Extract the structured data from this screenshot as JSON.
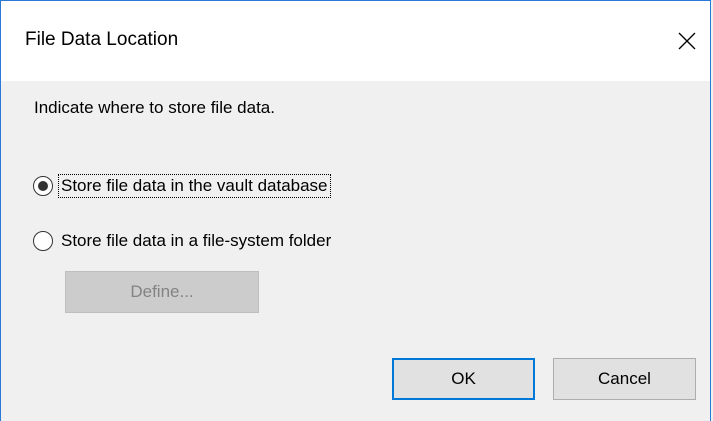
{
  "dialog": {
    "title": "File Data Location",
    "close_icon": "close-icon",
    "prompt": "Indicate where to store file data.",
    "options": [
      {
        "label": "Store file data in the vault database",
        "selected": true
      },
      {
        "label": "Store file data in a file-system folder",
        "selected": false
      }
    ],
    "define_label": "Define...",
    "ok_label": "OK",
    "cancel_label": "Cancel"
  },
  "colors": {
    "window_border": "#2b79d6",
    "titlebar_bg": "#ffffff",
    "body_bg": "#f0f0f0",
    "default_button_border": "#0078d7"
  }
}
